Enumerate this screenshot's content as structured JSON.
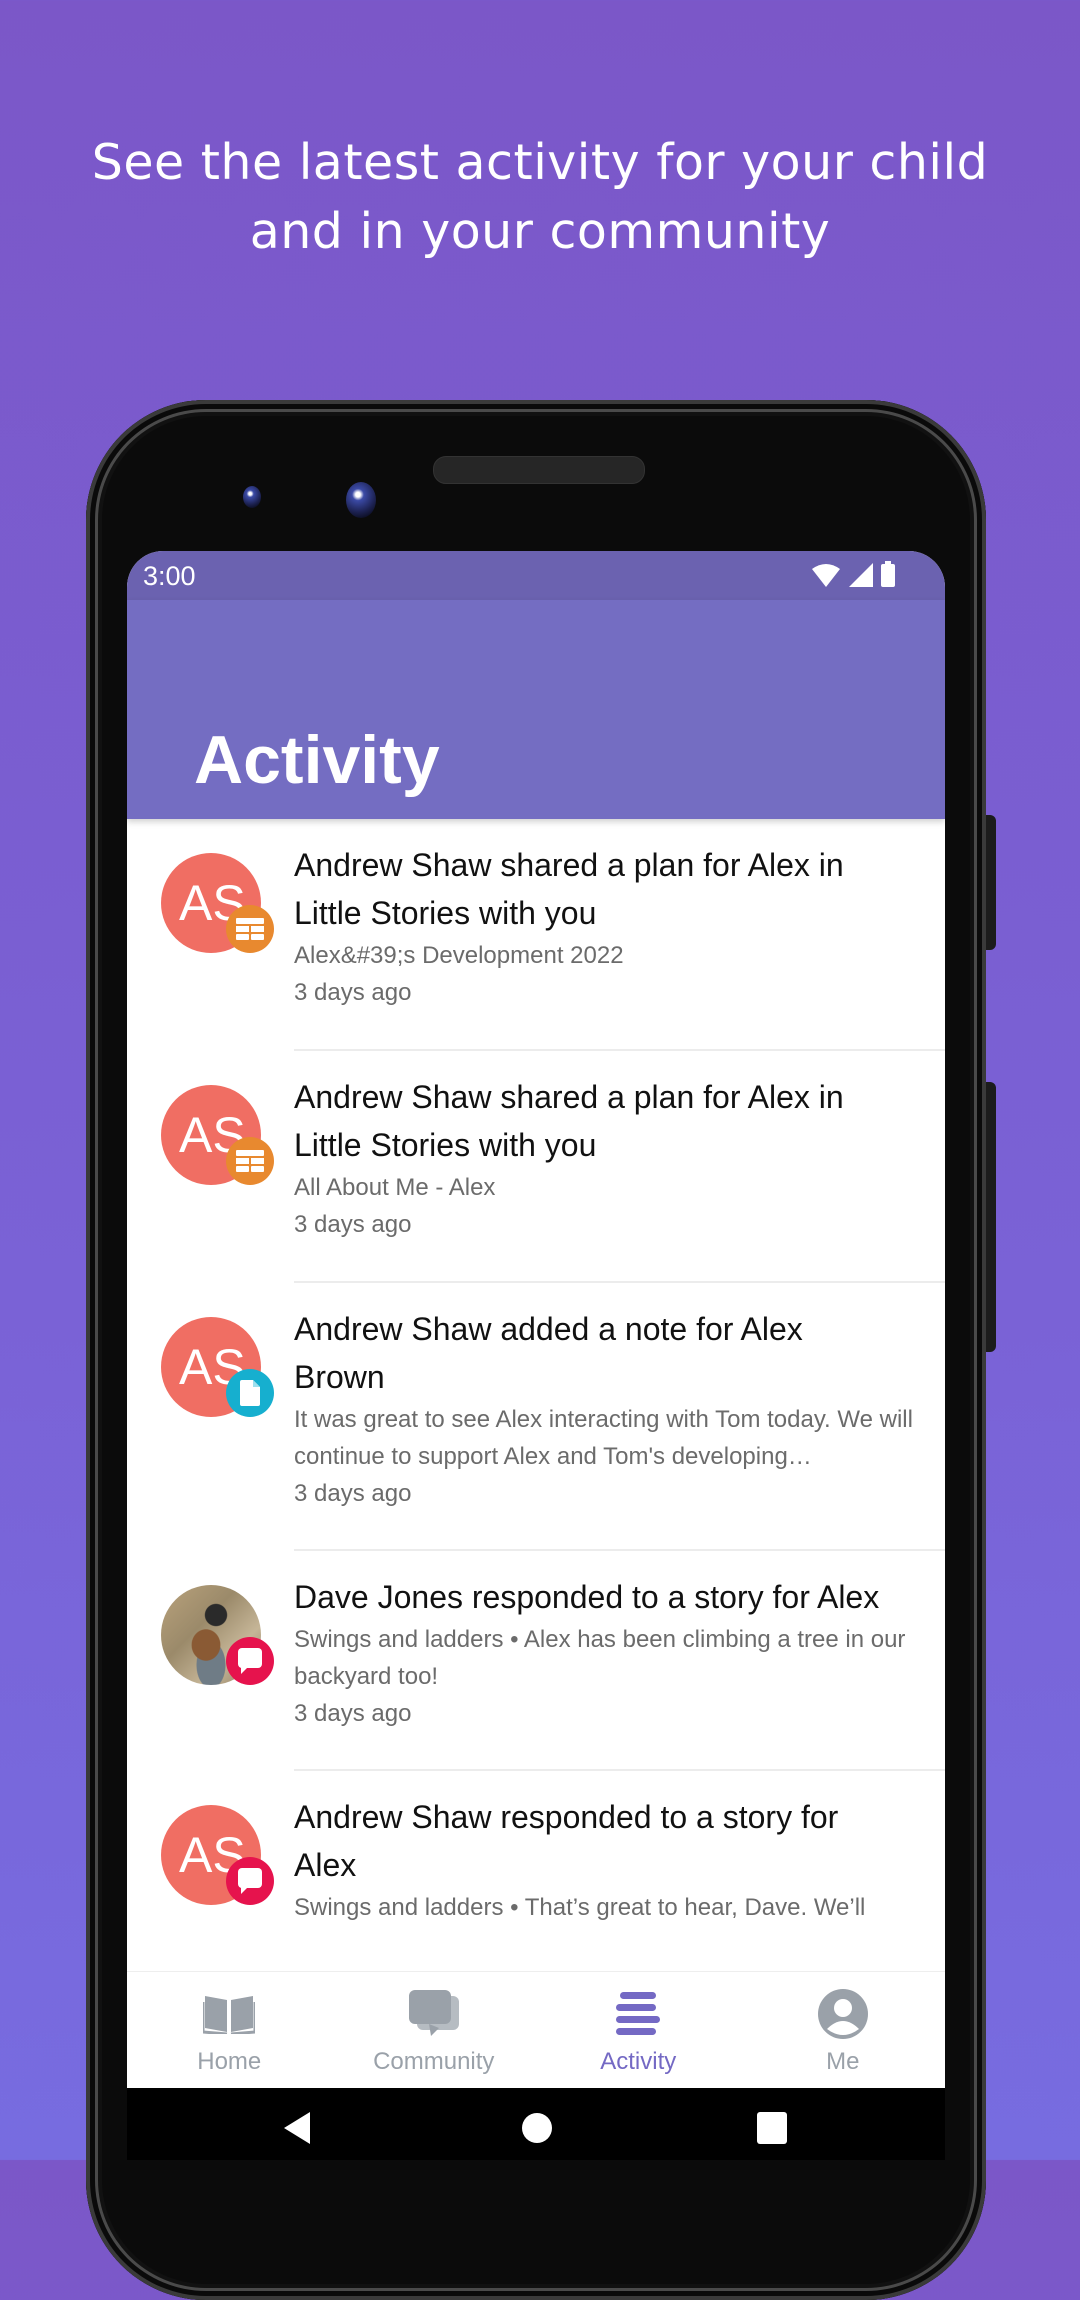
{
  "promo": {
    "headline_line1": "See the latest activity for your child",
    "headline_line2": "and in your community"
  },
  "colors": {
    "background": "#7B57C8",
    "status_bar": "#6B62B0",
    "app_bar": "#746DC2",
    "accent": "#7469C4",
    "avatar": "#F06E63",
    "badge_plan": "#E8892F",
    "badge_note": "#16AFCF",
    "badge_story": "#E6134D",
    "nav_inactive": "#9AA1A9"
  },
  "status_bar": {
    "time": "3:00",
    "icons": [
      "wifi-icon",
      "signal-icon",
      "battery-icon"
    ]
  },
  "app_bar": {
    "title": "Activity"
  },
  "activity": [
    {
      "avatar_initials": "AS",
      "badge_icon": "plan-icon",
      "title": "Andrew Shaw shared a plan for Alex in Little Stories with you",
      "subtitle": "Alex&#39;s Development 2022",
      "time": "3 days ago"
    },
    {
      "avatar_initials": "AS",
      "badge_icon": "plan-icon",
      "title": "Andrew Shaw shared a plan for Alex in Little Stories with you",
      "subtitle": "All About Me - Alex",
      "time": "3 days ago"
    },
    {
      "avatar_initials": "AS",
      "badge_icon": "note-icon",
      "title": "Andrew Shaw added a note for Alex Brown",
      "subtitle": "It was great to see Alex interacting with Tom today. We will continue to support Alex and Tom's developing…",
      "time": "3 days ago"
    },
    {
      "avatar_initials": "",
      "avatar_photo": "cyclist-with-dog-photo",
      "badge_icon": "comment-icon",
      "title": "Dave Jones responded to a story for Alex",
      "subtitle": "Swings and ladders  • Alex has been climbing a tree in our backyard too!",
      "time": "3 days ago"
    },
    {
      "avatar_initials": "AS",
      "badge_icon": "comment-icon",
      "title": "Andrew Shaw responded to a story for Alex",
      "subtitle": "Swings and ladders  • That’s great to hear, Dave. We’ll",
      "time": ""
    }
  ],
  "bottom_nav": [
    {
      "label": "Home",
      "icon": "book-icon",
      "active": false
    },
    {
      "label": "Community",
      "icon": "chat-icon",
      "active": false
    },
    {
      "label": "Activity",
      "icon": "activity-list-icon",
      "active": true
    },
    {
      "label": "Me",
      "icon": "person-icon",
      "active": false
    }
  ],
  "system_nav": [
    "back-icon",
    "home-icon",
    "recents-icon"
  ]
}
